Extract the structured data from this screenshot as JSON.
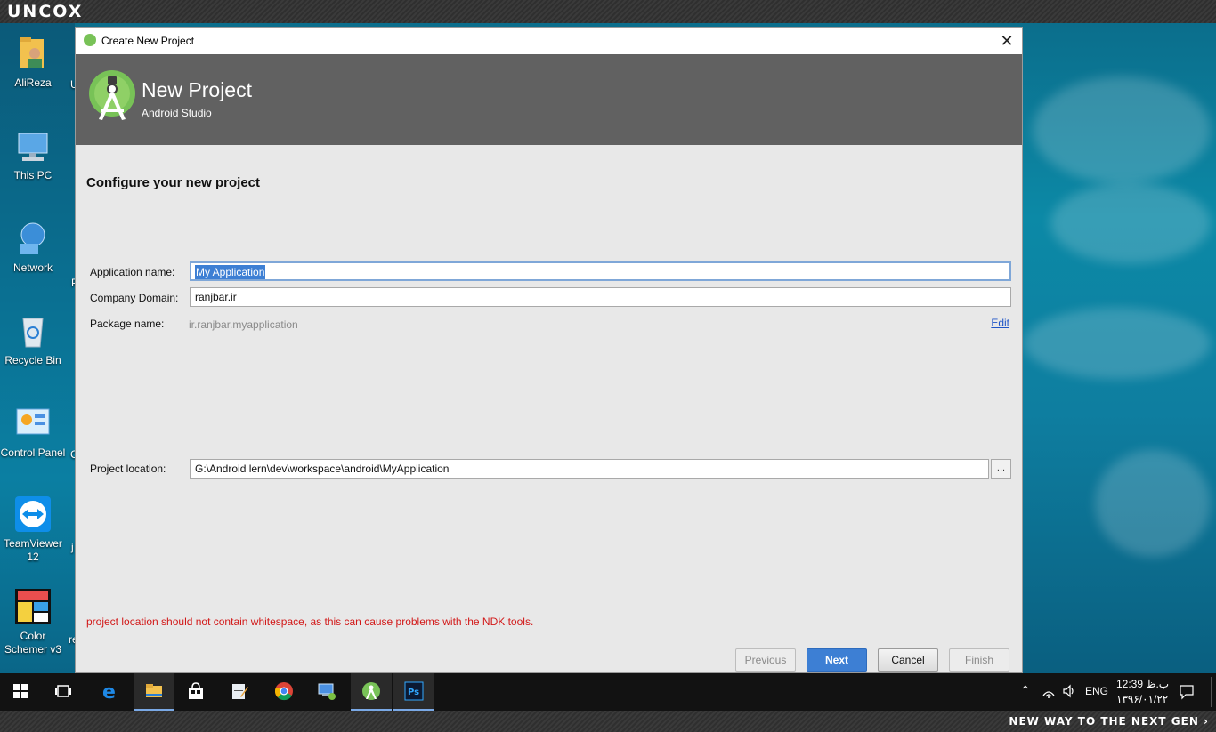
{
  "brand": {
    "logo_text": "UNCOX",
    "slogan": "NEW WAY TO THE NEXT GEN ›"
  },
  "desktop": {
    "icons": [
      {
        "label": "AliReza",
        "icon": "user-folder-icon"
      },
      {
        "label": "This PC",
        "icon": "computer-icon"
      },
      {
        "label": "Network",
        "icon": "network-icon"
      },
      {
        "label": "Recycle Bin",
        "icon": "recycle-bin-icon"
      },
      {
        "label": "Control Panel",
        "icon": "control-panel-icon"
      },
      {
        "label": "TeamViewer 12",
        "icon": "teamviewer-icon"
      },
      {
        "label": "Color Schemer v3",
        "icon": "color-schemer-icon"
      }
    ],
    "clipped_letters": [
      "U",
      "P",
      "C",
      "j",
      "re"
    ]
  },
  "dialog": {
    "window_title": "Create New Project",
    "header": {
      "title": "New Project",
      "subtitle": "Android Studio"
    },
    "section_title": "Configure your new project",
    "form": {
      "app_name_label": "Application name:",
      "app_name_value": "My Application",
      "company_domain_label": "Company Domain:",
      "company_domain_value": "ranjbar.ir",
      "package_name_label": "Package name:",
      "package_name_value": "ir.ranjbar.myapplication",
      "edit_link": "Edit",
      "project_location_label": "Project location:",
      "project_location_value": "G:\\Android lern\\dev\\workspace\\android\\MyApplication",
      "browse_label": "..."
    },
    "error_message": "project location should not contain whitespace, as this can cause problems with the NDK tools.",
    "buttons": {
      "previous": "Previous",
      "next": "Next",
      "cancel": "Cancel",
      "finish": "Finish"
    }
  },
  "taskbar": {
    "items": [
      "start-button",
      "task-view",
      "edge",
      "file-explorer",
      "store",
      "notepad",
      "chrome",
      "remote-desktop",
      "android-studio",
      "photoshop"
    ],
    "active_item": "android-studio",
    "tray": {
      "language": "ENG",
      "time": "12:39 ب.ظ",
      "date": "۱۳۹۶/۰۱/۲۲"
    }
  },
  "colors": {
    "accent": "#3d7fd4",
    "header_bg": "#616161",
    "android_green": "#78c257",
    "error": "#d21818"
  }
}
